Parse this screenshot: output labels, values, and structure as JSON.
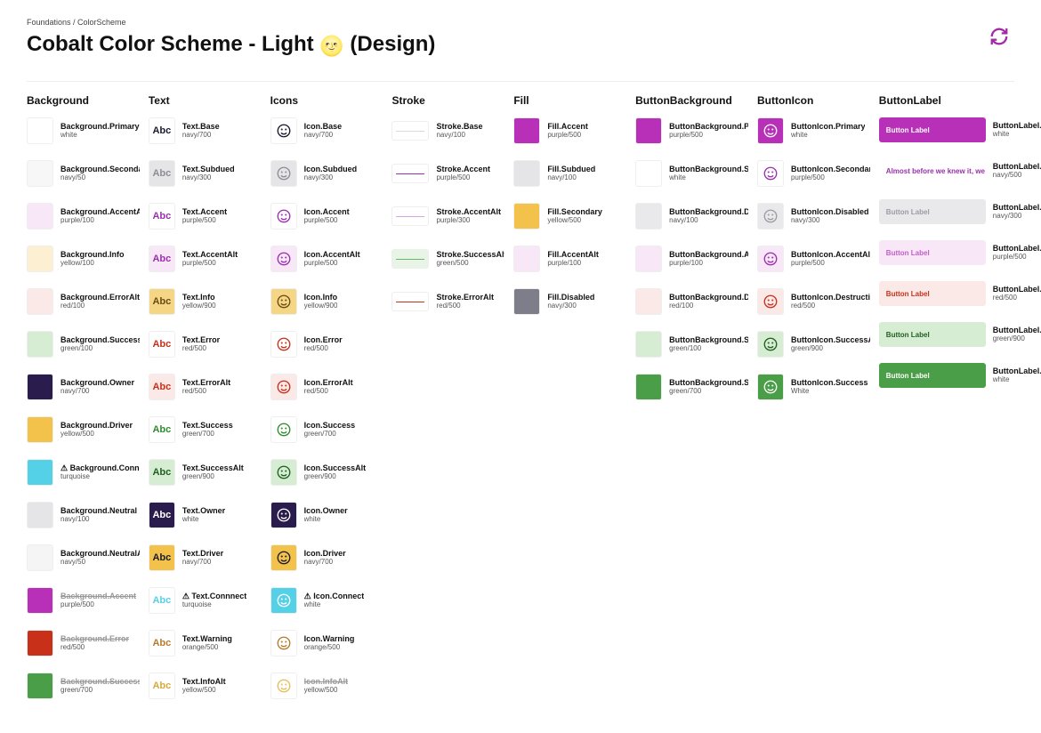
{
  "breadcrumb": "Foundations / ColorScheme",
  "title_prefix": "Cobalt Color Scheme - Light ",
  "title_suffix": " (Design)",
  "emoji": "🌝",
  "abc": "Abc",
  "long_sample": "Almost before we knew it, we had left the g",
  "btn_text": "Button Label",
  "columns": {
    "bg": {
      "title": "Background"
    },
    "text": {
      "title": "Text"
    },
    "icons": {
      "title": "Icons"
    },
    "stroke": {
      "title": "Stroke"
    },
    "fill": {
      "title": "Fill"
    },
    "bbg": {
      "title": "ButtonBackground"
    },
    "bicon": {
      "title": "ButtonIcon"
    },
    "blabel": {
      "title": "ButtonLabel"
    }
  },
  "bg": [
    {
      "name": "Background.Primary",
      "val": "white",
      "bg": "#ffffff"
    },
    {
      "name": "Background.Secondary",
      "val": "navy/50",
      "bg": "#f7f7f8"
    },
    {
      "name": "Background.AccentAlt",
      "val": "purple/100",
      "bg": "#F7E7F7"
    },
    {
      "name": "Background.Info",
      "val": "yellow/100",
      "bg": "#FDEFD2"
    },
    {
      "name": "Background.ErrorAlt",
      "val": "red/100",
      "bg": "#FBE9E7"
    },
    {
      "name": "Background.SuccessAlt",
      "val": "green/100",
      "bg": "#D6EDD4"
    },
    {
      "name": "Background.Owner",
      "val": "navy/700",
      "bg": "#2A1D4D"
    },
    {
      "name": "Background.Driver",
      "val": "yellow/500",
      "bg": "#F3C24B"
    },
    {
      "name": "⚠ Background.Connect",
      "val": "turquoise",
      "bg": "#55D1E7"
    },
    {
      "name": "Background.Neutral",
      "val": "navy/100",
      "bg": "#E5E5E8"
    },
    {
      "name": "Background.NeutralAlt",
      "val": "navy/50",
      "bg": "#F5F5F6"
    },
    {
      "name": "Background.Accent",
      "val": "purple/500",
      "bg": "#B930B8",
      "strike": true
    },
    {
      "name": "Background.Error",
      "val": "red/500",
      "bg": "#C8301A",
      "strike": true
    },
    {
      "name": "Background.Success",
      "val": "green/700",
      "bg": "#4A9E47",
      "strike": true
    }
  ],
  "text": [
    {
      "name": "Text.Base",
      "val": "navy/700",
      "bg": "#ffffff",
      "fg": "#1A1A2E"
    },
    {
      "name": "Text.Subdued",
      "val": "navy/300",
      "bg": "#E5E5E8",
      "fg": "#8c8c94"
    },
    {
      "name": "Text.Accent",
      "val": "purple/500",
      "bg": "#ffffff",
      "fg": "#9B2FAE"
    },
    {
      "name": "Text.AccentAlt",
      "val": "purple/500",
      "bg": "#F7E7F7",
      "fg": "#9B2FAE"
    },
    {
      "name": "Text.Info",
      "val": "yellow/900",
      "bg": "#F4D684",
      "fg": "#6a4a12"
    },
    {
      "name": "Text.Error",
      "val": "red/500",
      "bg": "#ffffff",
      "fg": "#C8301A"
    },
    {
      "name": "Text.ErrorAlt",
      "val": "red/500",
      "bg": "#FBE9E7",
      "fg": "#C8301A"
    },
    {
      "name": "Text.Success",
      "val": "green/700",
      "bg": "#ffffff",
      "fg": "#2E8B2E"
    },
    {
      "name": "Text.SuccessAlt",
      "val": "green/900",
      "bg": "#D6EDD4",
      "fg": "#1F5F1F"
    },
    {
      "name": "Text.Owner",
      "val": "white",
      "bg": "#2A1D4D",
      "fg": "#ffffff"
    },
    {
      "name": "Text.Driver",
      "val": "navy/700",
      "bg": "#F3C24B",
      "fg": "#1A1A2E"
    },
    {
      "name": "⚠ Text.Connnect",
      "val": "turquoise",
      "bg": "#ffffff",
      "fg": "#55D1E7"
    },
    {
      "name": "Text.Warning",
      "val": "orange/500",
      "bg": "#ffffff",
      "fg": "#B67A2B"
    },
    {
      "name": "Text.InfoAlt",
      "val": "yellow/500",
      "bg": "#ffffff",
      "fg": "#D9A83A"
    }
  ],
  "icons": [
    {
      "name": "Icon.Base",
      "val": "navy/700",
      "bg": "#ffffff",
      "fg": "#1A1A2E"
    },
    {
      "name": "Icon.Subdued",
      "val": "navy/300",
      "bg": "#E5E5E8",
      "fg": "#8c8c94"
    },
    {
      "name": "Icon.Accent",
      "val": "purple/500",
      "bg": "#ffffff",
      "fg": "#9B2FAE"
    },
    {
      "name": "Icon.AccentAlt",
      "val": "purple/500",
      "bg": "#F7E7F7",
      "fg": "#9B2FAE"
    },
    {
      "name": "Icon.Info",
      "val": "yellow/900",
      "bg": "#F4D684",
      "fg": "#6a4a12"
    },
    {
      "name": "Icon.Error",
      "val": "red/500",
      "bg": "#ffffff",
      "fg": "#C8301A"
    },
    {
      "name": "Icon.ErrorAlt",
      "val": "red/500",
      "bg": "#FBE9E7",
      "fg": "#C8301A"
    },
    {
      "name": "Icon.Success",
      "val": "green/700",
      "bg": "#ffffff",
      "fg": "#2E8B2E"
    },
    {
      "name": "Icon.SuccessAlt",
      "val": "green/900",
      "bg": "#D6EDD4",
      "fg": "#1F5F1F"
    },
    {
      "name": "Icon.Owner",
      "val": "white",
      "bg": "#2A1D4D",
      "fg": "#ffffff"
    },
    {
      "name": "Icon.Driver",
      "val": "navy/700",
      "bg": "#F3C24B",
      "fg": "#1A1A2E"
    },
    {
      "name": "⚠ Icon.Connect",
      "val": "white",
      "bg": "#55D1E7",
      "fg": "#ffffff"
    },
    {
      "name": "Icon.Warning",
      "val": "orange/500",
      "bg": "#ffffff",
      "fg": "#B67A2B"
    },
    {
      "name": "Icon.InfoAlt",
      "val": "yellow/500",
      "bg": "#ffffff",
      "fg": "#E7BE5A",
      "strike": true
    }
  ],
  "stroke": [
    {
      "name": "Stroke.Base",
      "val": "navy/100",
      "c": "#D8D8DE"
    },
    {
      "name": "Stroke.Accent",
      "val": "purple/500",
      "c": "#9B2FAE"
    },
    {
      "name": "Stroke.AccentAlt",
      "val": "purple/300",
      "c": "#D7A3E0"
    },
    {
      "name": "Stroke.SuccessAlt",
      "val": "green/500",
      "c": "#6AB568",
      "bg": "#E7F4E6"
    },
    {
      "name": "Stroke.ErrorAlt",
      "val": "red/500",
      "c": "#C8301A"
    }
  ],
  "fill": [
    {
      "name": "Fill.Accent",
      "val": "purple/500",
      "bg": "#B930B8"
    },
    {
      "name": "Fill.Subdued",
      "val": "navy/100",
      "bg": "#E5E5E8"
    },
    {
      "name": "Fill.Secondary",
      "val": "yellow/500",
      "bg": "#F3C24B"
    },
    {
      "name": "Fill.AccentAlt",
      "val": "purple/100",
      "bg": "#F7E7F7"
    },
    {
      "name": "Fill.Disabled",
      "val": "navy/300",
      "bg": "#7E7E8A"
    }
  ],
  "bbg": [
    {
      "name": "ButtonBackground.Primary",
      "val": "purple/500",
      "bg": "#B930B8"
    },
    {
      "name": "ButtonBackground.Secondary",
      "val": "white",
      "bg": "#ffffff"
    },
    {
      "name": "ButtonBackground.Disabled",
      "val": "navy/100",
      "bg": "#E9E9EC"
    },
    {
      "name": "ButtonBackground.AccentAlt",
      "val": "purple/100",
      "bg": "#F7E7F7"
    },
    {
      "name": "ButtonBackground.Destructive",
      "val": "red/100",
      "bg": "#FBE9E7"
    },
    {
      "name": "ButtonBackground.SuccessAlt",
      "val": "green/100",
      "bg": "#D6EDD4"
    },
    {
      "name": "ButtonBackground.Success",
      "val": "green/700",
      "bg": "#4A9E47"
    }
  ],
  "bicon": [
    {
      "name": "ButtonIcon.Primary",
      "val": "white",
      "bg": "#B930B8",
      "fg": "#ffffff"
    },
    {
      "name": "ButtonIcon.Secondary",
      "val": "purple/500",
      "bg": "#ffffff",
      "fg": "#9B2FAE"
    },
    {
      "name": "ButtonIcon.Disabled",
      "val": "navy/300",
      "bg": "#E9E9EC",
      "fg": "#9b9ba4"
    },
    {
      "name": "ButtonIcon.AccentAlt",
      "val": "purple/500",
      "bg": "#F7E7F7",
      "fg": "#9B2FAE"
    },
    {
      "name": "ButtonIcon.Destructive",
      "val": "red/500",
      "bg": "#FBE9E7",
      "fg": "#C8301A"
    },
    {
      "name": "ButtonIcon.SuccessAlt",
      "val": "green/900",
      "bg": "#D6EDD4",
      "fg": "#1F5F1F"
    },
    {
      "name": "ButtonIcon.Success",
      "val": "White",
      "bg": "#4A9E47",
      "fg": "#ffffff"
    }
  ],
  "blabel": [
    {
      "name": "ButtonLabel.Primary",
      "val": "white",
      "bg": "#B930B8",
      "fg": "#ffffff",
      "text": "btn"
    },
    {
      "name": "ButtonLabel.Secondary",
      "val": "navy/500",
      "bg": "#ffffff",
      "fg": "#9B2FAE",
      "text": "long"
    },
    {
      "name": "ButtonLabel.Disabled",
      "val": "navy/300",
      "bg": "#E9E9EC",
      "fg": "#9b9ba4",
      "text": "btn"
    },
    {
      "name": "ButtonLabel.AccentAlt",
      "val": "purple/500",
      "bg": "#F7E7F7",
      "fg": "#C35EC8",
      "text": "btn"
    },
    {
      "name": "ButtonLabel.Destructive",
      "val": "red/500",
      "bg": "#FBE9E7",
      "fg": "#C8301A",
      "text": "btn"
    },
    {
      "name": "ButtonLabel.SuccessAlt",
      "val": "green/900",
      "bg": "#D6EDD4",
      "fg": "#1F5F1F",
      "text": "btn"
    },
    {
      "name": "ButtonLabel.Success",
      "val": "white",
      "bg": "#4A9E47",
      "fg": "#ffffff",
      "text": "btn"
    }
  ]
}
